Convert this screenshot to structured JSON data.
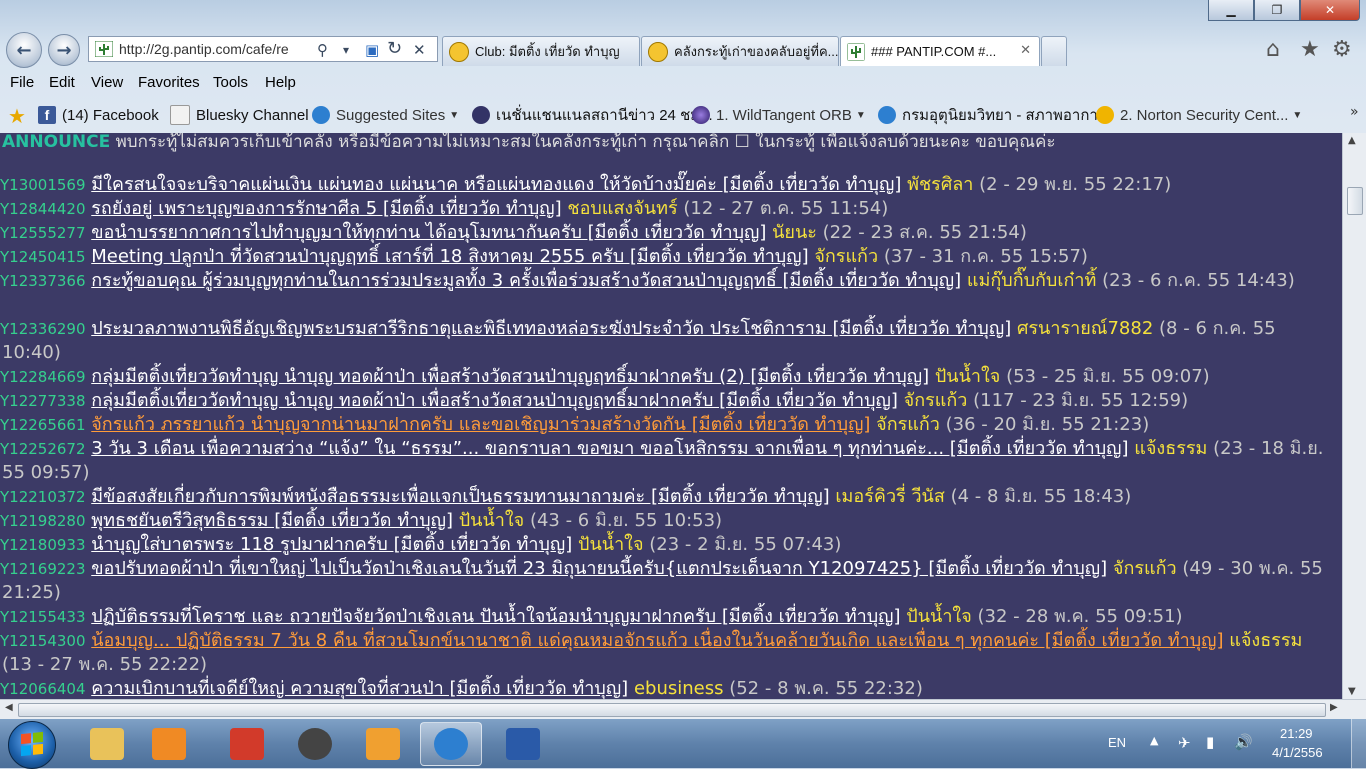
{
  "window": {
    "minimize": "▁",
    "maximize": "❐",
    "close": "✕"
  },
  "navbar": {
    "back_icon": "back-arrow-icon",
    "forward_icon": "forward-arrow-icon",
    "url": "http://2g.pantip.com/cafe/re",
    "search_glyph": "⚲",
    "dropdown_glyph": "▾",
    "refresh_glyph": "↻",
    "stop_glyph": "✕"
  },
  "tabs": [
    {
      "label": "Club: มีตติ้ง เที่ยวัด ทำบุญ",
      "icon": "smiley-icon"
    },
    {
      "label": "คลังกระทู้เก่าของคลับอยู่ที่ค...",
      "icon": "smiley-icon"
    },
    {
      "label": "### PANTIP.COM #...",
      "icon": "cactus-icon",
      "close": "✕"
    }
  ],
  "toolbar_right": {
    "home": "⌂",
    "favorites": "★",
    "tools": "⚙"
  },
  "menu": [
    "File",
    "Edit",
    "View",
    "Favorites",
    "Tools",
    "Help"
  ],
  "favorites_bar": [
    {
      "label": "(14) Facebook",
      "icon": "facebook-icon",
      "color": "#3b5998"
    },
    {
      "label": "Bluesky Channel",
      "icon": "page-icon",
      "color": "#e8e8e8"
    },
    {
      "label": "Suggested Sites",
      "icon": "ie-icon",
      "color": "#2d7fd0"
    },
    {
      "label": "เนชั่นแชนแนลสถานีข่าว 24 ชม...",
      "icon": "nation-icon",
      "color": "#333366"
    },
    {
      "label": "1. WildTangent ORB",
      "icon": "orb-icon",
      "color": "#5a3fa8"
    },
    {
      "label": "กรมอุตุนิยมวิทยา - สภาพอากา...",
      "icon": "ie-icon",
      "color": "#2d7fd0"
    },
    {
      "label": "2. Norton Security Cent...",
      "icon": "norton-icon",
      "color": "#f0b400"
    }
  ],
  "announce": {
    "tag": "ANNOUNCE",
    "text": "พบกระทู้ไม่สมควรเก็บเข้าคลัง หรือมีข้อความไม่เหมาะสมในคลังกระทู้เก่า กรุณาคลิก  ☐  ในกระทู้ เพื่อแจ้งลบด้วยนะคะ ขอบคุณค่ะ"
  },
  "topics": [
    {
      "id": "Y13001569",
      "title": "มีใครสนใจจะบริจาคแผ่นเงิน แผ่นทอง แผ่นนาค หรือแผ่นทองแดง ให้วัดบ้างมั๊ยค่ะ [มีตติ้ง เที่ยววัด ทำบุญ]",
      "author": "พัชรศิลา",
      "meta": "(2 - 29 พ.ย. 55 22:17)"
    },
    {
      "id": "Y12844420",
      "title": "รถยังอยู่ เพราะบุญของการรักษาศีล 5 [มีตติ้ง เที่ยววัด ทำบุญ]",
      "author": "ชอบแสงจันทร์",
      "meta": "(12 - 27 ต.ค. 55 11:54)"
    },
    {
      "id": "Y12555277",
      "title": "ขอนำบรรยากาศการไปทำบุญมาให้ทุกท่าน ได้อนุโมทนากันครับ [มีตติ้ง เที่ยววัด ทำบุญ]",
      "author": "นัยนะ",
      "meta": "(22 - 23 ส.ค. 55 21:54)"
    },
    {
      "id": "Y12450415",
      "title": "Meeting ปลูกป่า ที่วัดสวนป่าบุญฤทธิ์ เสาร์ที่ 18 สิงหาคม 2555 ครับ [มีตติ้ง เที่ยววัด ทำบุญ]",
      "author": "จักรแก้ว",
      "meta": "(37 - 31 ก.ค. 55 15:57)"
    },
    {
      "id": "Y12337366",
      "title": "กระทู้ขอบคุณ ผู้ร่วมบุญทุกท่านในการร่วมประมูลทั้ง 3 ครั้งเพื่อร่วมสร้างวัดสวนป่าบุญฤทธิ์ [มีตติ้ง เที่ยววัด ทำบุญ]",
      "author": "แม่กุ๊บกิ๊บกับเก๋าทิ้",
      "meta": "(23 - 6 ก.ค. 55 14:43)"
    },
    {
      "id": "Y12336290",
      "title": "ประมวลภาพงานพิธีอัญเชิญพระบรมสารีริกธาตุและพิธีเททองหล่อระฆังประจำวัด ประโชติการาม [มีตติ้ง เที่ยววัด ทำบุญ]",
      "author": "ศรนารายณ์7882",
      "meta": "(8 - 6 ก.ค. 55 10:40)"
    },
    {
      "id": "Y12284669",
      "title": "กลุ่มมีตติ้งเที่ยววัดทำบุญ นำบุญ ทอดผ้าป่า เพื่อสร้างวัดสวนป่าบุญฤทธิ์มาฝากครับ (2) [มีตติ้ง เที่ยววัด ทำบุญ]",
      "author": "ปันน้ำใจ",
      "meta": "(53 - 25 มิ.ย. 55 09:07)"
    },
    {
      "id": "Y12277338",
      "title": "กลุ่มมีตติ้งเที่ยววัดทำบุญ นำบุญ ทอดผ้าป่า เพื่อสร้างวัดสวนป่าบุญฤทธิ์มาฝากครับ [มีตติ้ง เที่ยววัด ทำบุญ]",
      "author": "จักรแก้ว",
      "meta": "(117 - 23 มิ.ย. 55 12:59)"
    },
    {
      "id": "Y12265661",
      "title": "จักรแก้ว ภรรยาแก้ว นำบุญจากน่านมาฝากครับ และขอเชิญมาร่วมสร้างวัดกัน [มีตติ้ง เที่ยววัด ทำบุญ]",
      "author": "จักรแก้ว",
      "meta": "(36 - 20 มิ.ย. 55 21:23)",
      "orange": true
    },
    {
      "id": "Y12252672",
      "title": "3 วัน 3 เดือน เพื่อความสว่าง “แจ้ง” ใน “ธรรม”... ขอกราบลา ขอขมา ขออโหสิกรรม จากเพื่อน ๆ ทุกท่านค่ะ... [มีตติ้ง เที่ยววัด ทำบุญ]",
      "author": "แจ้งธรรม",
      "meta": "(23 - 18 มิ.ย. 55 09:57)"
    },
    {
      "id": "Y12210372",
      "title": "มีข้อสงสัยเกี่ยวกับการพิมพ์หนังสือธรรมะเพื่อแจกเป็นธรรมทานมาถามค่ะ [มีตติ้ง เที่ยววัด ทำบุญ]",
      "author": "เมอร์คิวรี่ วีนัส",
      "meta": "(4 - 8 มิ.ย. 55 18:43)"
    },
    {
      "id": "Y12198280",
      "title": "พุทธชยันตรีวิสุทธิธรรม [มีตติ้ง เที่ยววัด ทำบุญ]",
      "author": "ปันน้ำใจ",
      "meta": "(43 - 6 มิ.ย. 55 10:53)"
    },
    {
      "id": "Y12180933",
      "title": "นำบุญใส่บาตรพระ 118 รูปมาฝากครับ [มีตติ้ง เที่ยววัด ทำบุญ]",
      "author": "ปันน้ำใจ",
      "meta": "(23 - 2 มิ.ย. 55 07:43)"
    },
    {
      "id": "Y12169223",
      "title": "ขอปรับทอดผ้าป่า ที่เขาใหญ่ ไปเป็นวัดป่าเชิงเลนในวันที่ 23 มิถุนายนนี้ครับ{แตกประเด็นจาก Y12097425} [มีตติ้ง เที่ยววัด ทำบุญ]",
      "author": "จักรแก้ว",
      "meta": "(49 - 30 พ.ค. 55 21:25)"
    },
    {
      "id": "Y12155433",
      "title": "ปฏิบัติธรรมที่โคราช และ ถวายปัจจัยวัดป่าเชิงเลน ปันน้ำใจน้อมนำบุญมาฝากครับ [มีตติ้ง เที่ยววัด ทำบุญ]",
      "author": "ปันน้ำใจ",
      "meta": "(32 - 28 พ.ค. 55 09:51)"
    },
    {
      "id": "Y12154300",
      "title": "น้อมบุญ... ปฏิบัติธรรม 7 วัน 8 คืน ที่สวนโมกข์นานาชาติ แด่คุณหมอจักรแก้ว เนื่องในวันคล้ายวันเกิด และเพื่อน ๆ ทุกคนค่ะ [มีตติ้ง เที่ยววัด ทำบุญ]",
      "author": "แจ้งธรรม",
      "meta": "(13 - 27 พ.ค. 55 22:22)",
      "orange": true
    },
    {
      "id": "Y12066404",
      "title": "ความเบิกบานที่เจดีย์ใหญ่ ความสุขใจที่สวนป่า [มีตติ้ง เที่ยววัด ทำบุญ]",
      "author": "ebusiness",
      "meta": "(52 - 8 พ.ค. 55 22:32)"
    }
  ],
  "taskbar": {
    "apps": [
      {
        "name": "explorer",
        "color": "#e9c25a"
      },
      {
        "name": "media-player",
        "color": "#f08a24"
      },
      {
        "name": "pin",
        "color": "#d23a2a"
      },
      {
        "name": "clock-app",
        "color": "#444444"
      },
      {
        "name": "outlook",
        "color": "#f0a030"
      },
      {
        "name": "internet-explorer",
        "color": "#2d7fd0",
        "active": true
      },
      {
        "name": "word",
        "color": "#2a5aa8"
      }
    ],
    "lang": "EN",
    "time": "21:29",
    "date": "4/1/2556"
  }
}
